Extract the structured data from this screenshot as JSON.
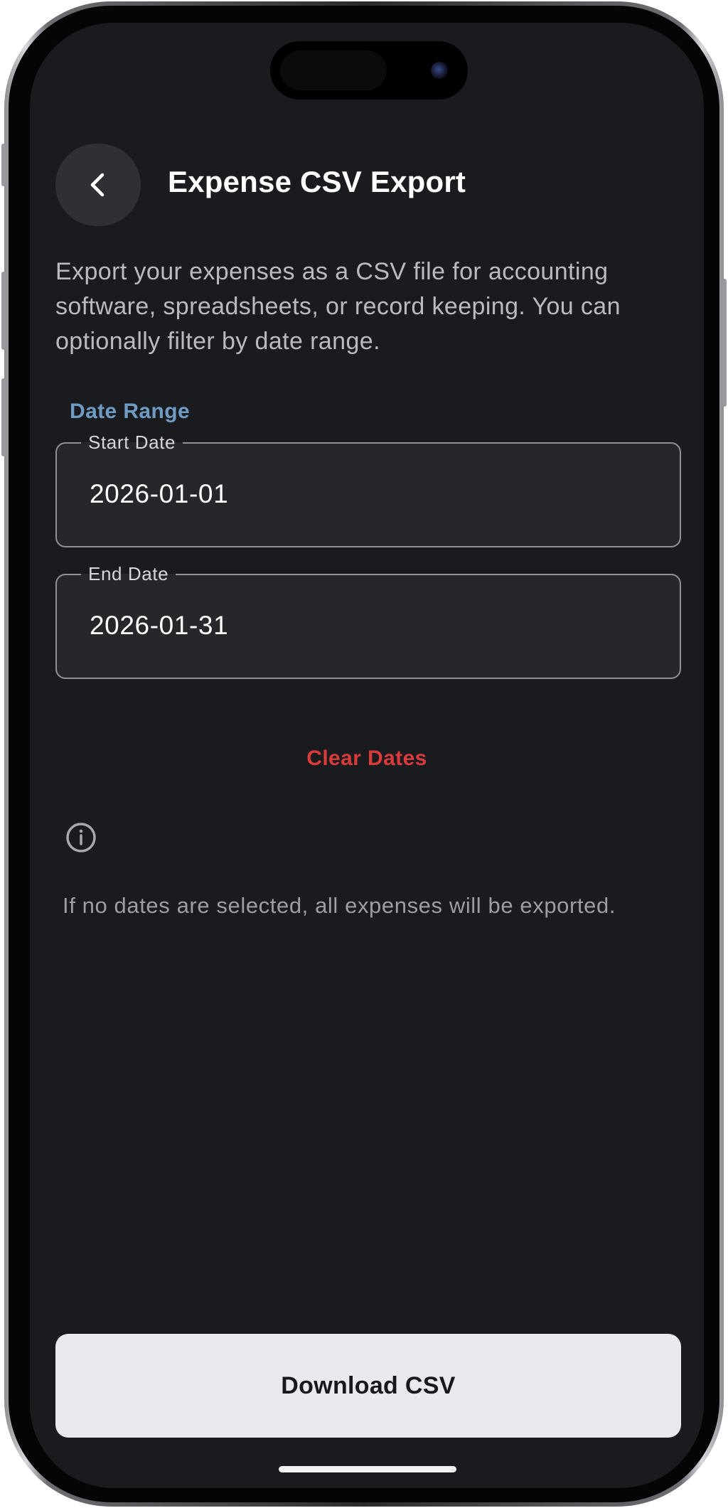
{
  "header": {
    "title": "Expense CSV Export",
    "back_icon": "chevron-left-icon"
  },
  "description": "Export your expenses as a CSV file for accounting software, spreadsheets, or record keeping. You can optionally filter by date range.",
  "date_range": {
    "section_label": "Date Range",
    "start": {
      "label": "Start Date",
      "value": "2026-01-01"
    },
    "end": {
      "label": "End Date",
      "value": "2026-01-31"
    },
    "clear_label": "Clear Dates"
  },
  "info": {
    "icon": "info-circle-icon",
    "text": "If no dates are selected, all expenses will be exported."
  },
  "actions": {
    "download_label": "Download CSV"
  },
  "colors": {
    "background": "#191b1e",
    "accent_label": "#6f9cc4",
    "danger": "#d93a3a",
    "button_bg": "#e8eaf0"
  }
}
